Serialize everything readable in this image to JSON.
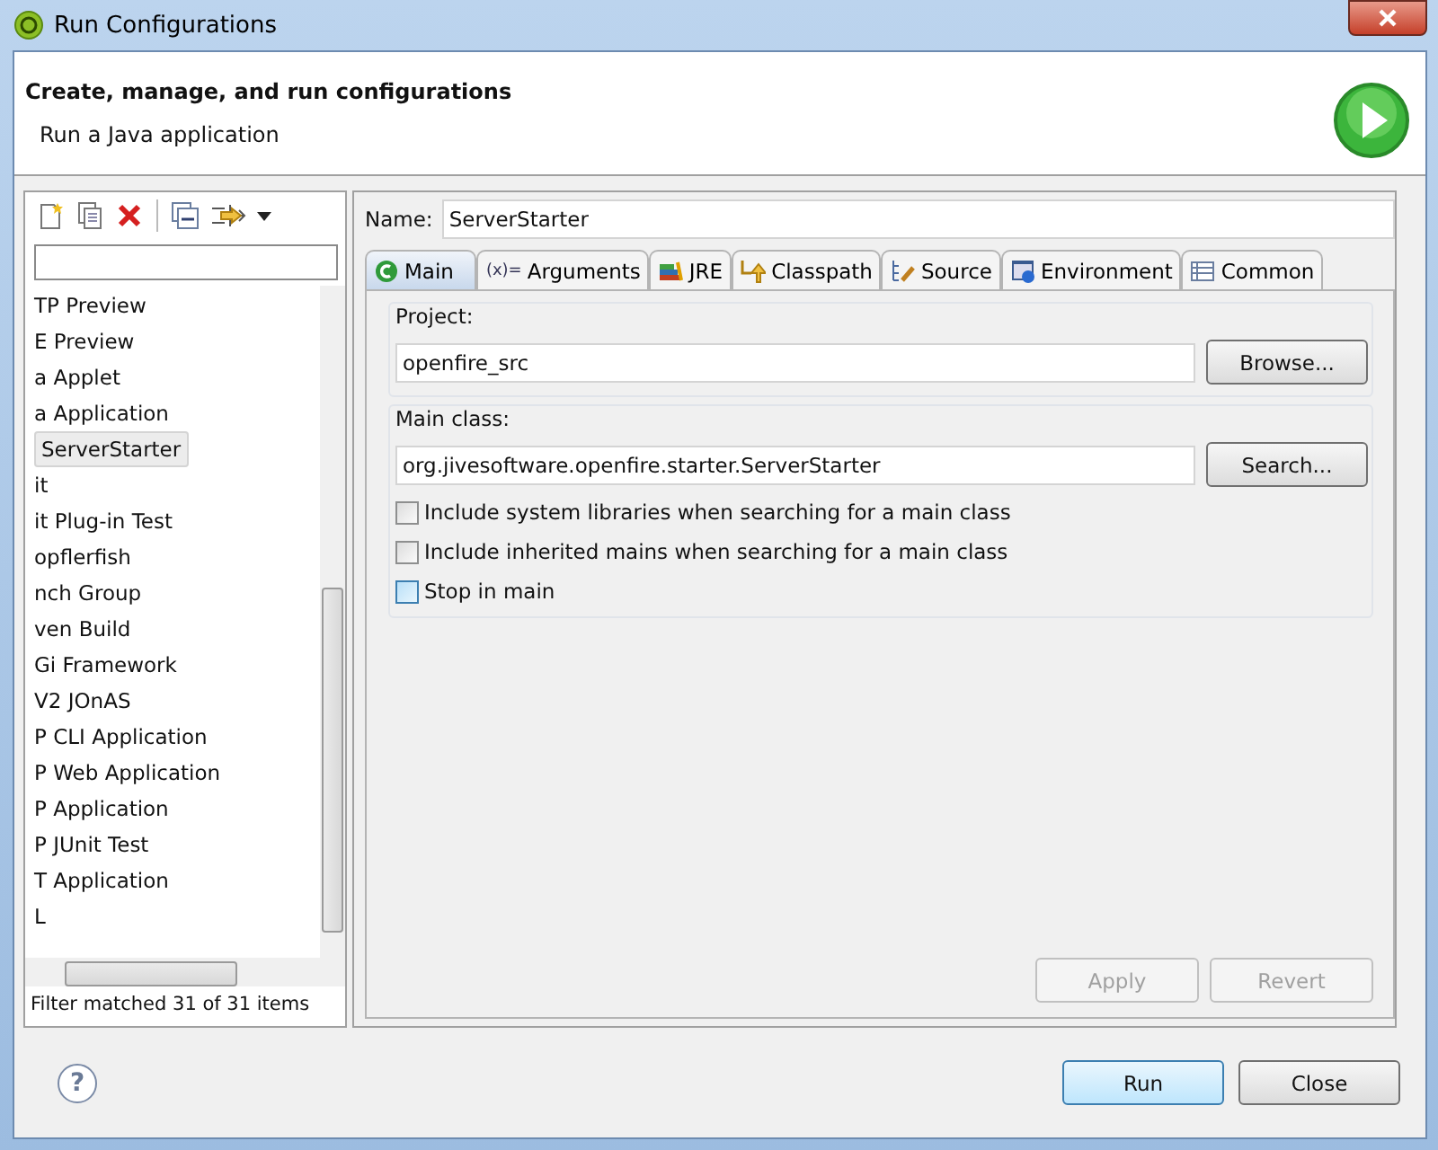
{
  "window": {
    "title": "Run Configurations"
  },
  "header": {
    "title": "Create, manage, and run configurations",
    "subtitle": "Run a Java application"
  },
  "sidebar": {
    "items": [
      {
        "label": "TP Preview",
        "selected": false
      },
      {
        "label": "E Preview",
        "selected": false
      },
      {
        "label": "a Applet",
        "selected": false
      },
      {
        "label": "a Application",
        "selected": false,
        "children": [
          {
            "label": "ServerStarter",
            "selected": true
          }
        ]
      },
      {
        "label": "it",
        "selected": false
      },
      {
        "label": "it Plug-in Test",
        "selected": false
      },
      {
        "label": "opflerfish",
        "selected": false
      },
      {
        "label": "nch Group",
        "selected": false
      },
      {
        "label": "ven Build",
        "selected": false
      },
      {
        "label": "Gi Framework",
        "selected": false
      },
      {
        "label": "V2 JOnAS",
        "selected": false
      },
      {
        "label": "P CLI Application",
        "selected": false
      },
      {
        "label": "P Web Application",
        "selected": false
      },
      {
        "label": "P Application",
        "selected": false
      },
      {
        "label": "P JUnit Test",
        "selected": false
      },
      {
        "label": "T Application",
        "selected": false
      },
      {
        "label": "L",
        "selected": false
      }
    ],
    "status": "Filter matched 31 of 31 items"
  },
  "name_field": {
    "label": "Name:",
    "value": "ServerStarter"
  },
  "tabs": [
    {
      "label": "Main",
      "selected": true
    },
    {
      "label": "Arguments",
      "selected": false,
      "symbol": "(x)="
    },
    {
      "label": "JRE",
      "selected": false
    },
    {
      "label": "Classpath",
      "selected": false
    },
    {
      "label": "Source",
      "selected": false
    },
    {
      "label": "Environment",
      "selected": false
    },
    {
      "label": "Common",
      "selected": false
    }
  ],
  "project": {
    "label": "Project:",
    "value": "openfire_src",
    "button": "Browse..."
  },
  "main_class": {
    "label": "Main class:",
    "value": "org.jivesoftware.openfire.starter.ServerStarter",
    "button": "Search..."
  },
  "options": [
    {
      "label": "Include system libraries when searching for a main class",
      "checked": false,
      "hover": false
    },
    {
      "label": "Include inherited mains when searching for a main class",
      "checked": false,
      "hover": false
    },
    {
      "label": "Stop in main",
      "checked": false,
      "hover": true
    }
  ],
  "config_buttons": [
    {
      "label": "Apply",
      "disabled": true
    },
    {
      "label": "Revert",
      "disabled": true
    }
  ],
  "help_button": "?",
  "dialog_buttons": [
    {
      "label": "Run",
      "default": true
    },
    {
      "label": "Close",
      "default": false
    }
  ]
}
